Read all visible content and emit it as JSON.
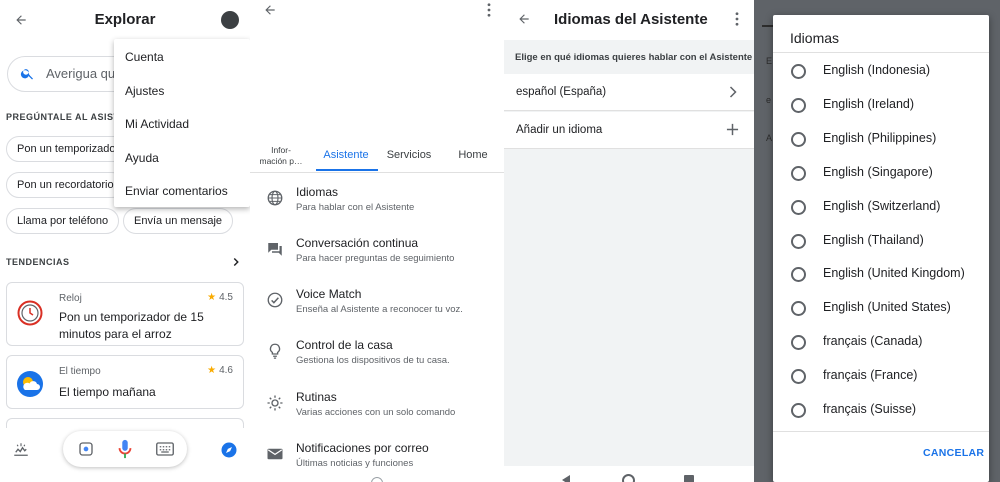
{
  "colors": {
    "accent": "#1a73e8",
    "star": "#f9ab00",
    "mic_red": "#ea4335",
    "overlay": "#5f6368"
  },
  "panel1": {
    "title": "Explorar",
    "search_placeholder": "Averigua qué",
    "ask_section": "PREGÚNTALE AL ASISTE",
    "chips": [
      "Pon un temporizador",
      "Pon un recordatorio",
      "Llama por teléfono",
      "Envía un mensaje"
    ],
    "trends_label": "TENDENCIAS",
    "cards": [
      {
        "category": "Reloj",
        "rating": "4.5",
        "text": "Pon un temporizador de 15 minutos para el arroz",
        "icon": "clock-icon"
      },
      {
        "category": "El tiempo",
        "rating": "4.6",
        "text": "El tiempo mañana",
        "icon": "weather-icon"
      }
    ],
    "menu": [
      "Cuenta",
      "Ajustes",
      "Mi Actividad",
      "Ayuda",
      "Enviar comentarios"
    ]
  },
  "panel2": {
    "tabs": [
      {
        "label": "Infor-\nmación p…",
        "active": false
      },
      {
        "label": "Asistente",
        "active": true
      },
      {
        "label": "Servicios",
        "active": false
      },
      {
        "label": "Home",
        "active": false
      }
    ],
    "items": [
      {
        "title": "Idiomas",
        "subtitle": "Para hablar con el Asistente",
        "icon": "globe-icon"
      },
      {
        "title": "Conversación continua",
        "subtitle": "Para hacer preguntas de seguimiento",
        "icon": "chat-icon"
      },
      {
        "title": "Voice Match",
        "subtitle": "Enseña al Asistente a reconocer tu voz.",
        "icon": "voice-match-icon"
      },
      {
        "title": "Control de la casa",
        "subtitle": "Gestiona los dispositivos de tu casa.",
        "icon": "lightbulb-icon"
      },
      {
        "title": "Rutinas",
        "subtitle": "Varias acciones con un solo comando",
        "icon": "routines-icon"
      },
      {
        "title": "Notificaciones por correo",
        "subtitle": "Últimas noticias y funciones",
        "icon": "mail-icon"
      }
    ]
  },
  "panel3": {
    "title": "Idiomas del Asistente",
    "caption": "Elige en qué idiomas quieres hablar con el Asistente",
    "language": "español (España)",
    "add_language": "Añadir un idioma"
  },
  "panel4": {
    "title": "Idiomas",
    "options": [
      "English (Indonesia)",
      "English (Ireland)",
      "English (Philippines)",
      "English (Singapore)",
      "English (Switzerland)",
      "English (Thailand)",
      "English (United Kingdom)",
      "English (United States)",
      "français (Canada)",
      "français (France)",
      "français (Suisse)"
    ],
    "cancel": "CANCELAR"
  }
}
